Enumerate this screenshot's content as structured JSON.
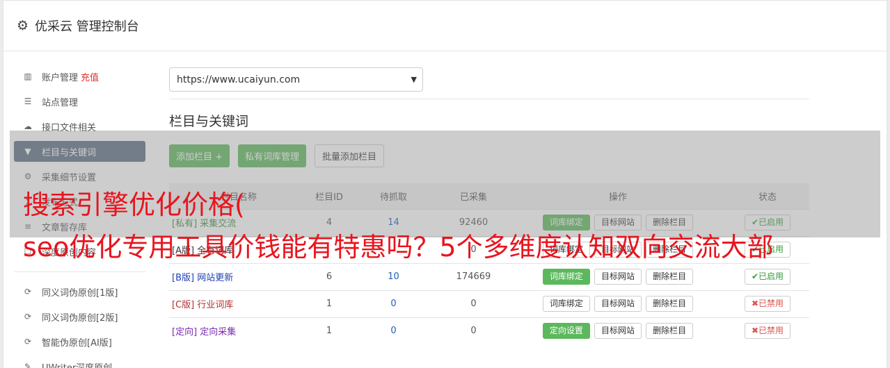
{
  "header": {
    "gear_icon": "gear-icon",
    "title": "优采云 管理控制台"
  },
  "sidebar": {
    "items": [
      {
        "icon": "bar-chart-icon",
        "label": "账户管理",
        "extra": "充值"
      },
      {
        "icon": "server-icon",
        "label": "站点管理"
      },
      {
        "icon": "cloud-upload-icon",
        "label": "接口文件相关"
      },
      {
        "icon": "filter-icon",
        "label": "栏目与关键词"
      },
      {
        "icon": "gears-icon",
        "label": "采集细节设置"
      },
      {
        "icon": "publish-icon",
        "label": "发布方式"
      },
      {
        "icon": "database-icon",
        "label": "文章暂存库"
      },
      {
        "icon": "square-icon",
        "label": "深度原创内容"
      }
    ],
    "items2": [
      {
        "icon": "refresh-icon",
        "label": "同义词伪原创[1版]"
      },
      {
        "icon": "refresh-icon",
        "label": "同义词伪原创[2版]"
      },
      {
        "icon": "refresh-icon",
        "label": "智能伪原创[AI版]"
      },
      {
        "icon": "edit-icon",
        "label": "UWriter深度原创"
      }
    ]
  },
  "site_select": {
    "value": "https://www.ucaiyun.com"
  },
  "section_title": "栏目与关键词",
  "buttons": {
    "add": "添加栏目 +",
    "private_lib": "私有词库管理",
    "batch_add": "批量添加栏目"
  },
  "table": {
    "headers": [
      "栏目名称",
      "栏目ID",
      "待抓取",
      "已采集",
      "操作",
      "状态"
    ],
    "rows": [
      {
        "name": "[私有] 采集交流",
        "color": "#3a8a3a",
        "id": "4",
        "pending": "14",
        "collected": "92460",
        "op1": "词库绑定",
        "op1_green": true,
        "op2": "目标网站",
        "op3": "删除栏目",
        "status": "已启用",
        "on": true
      },
      {
        "name": "[A版] 全有词库",
        "color": "#333333",
        "id": "",
        "pending": "",
        "collected": "0",
        "op1": "词库绑定",
        "op1_green": false,
        "op2": "目标网站",
        "op3": "删除栏目",
        "status": "已启用",
        "on": true
      },
      {
        "name": "[B版] 网站更新",
        "color": "#1e3fb4",
        "id": "6",
        "pending": "10",
        "collected": "174669",
        "op1": "词库绑定",
        "op1_green": true,
        "op2": "目标网站",
        "op3": "删除栏目",
        "status": "已启用",
        "on": true
      },
      {
        "name": "[C版] 行业词库",
        "color": "#b03030",
        "id": "1",
        "pending": "0",
        "collected": "0",
        "op1": "词库绑定",
        "op1_green": false,
        "op2": "目标网站",
        "op3": "删除栏目",
        "status": "已禁用",
        "on": false
      },
      {
        "name": "[定向] 定向采集",
        "color": "#7a2ab0",
        "id": "1",
        "pending": "0",
        "collected": "0",
        "op1": "定向设置",
        "op1_green": true,
        "op2": "目标网站",
        "op3": "删除栏目",
        "status": "已禁用",
        "on": false
      }
    ]
  },
  "ad": {
    "line1": "搜索引擎优化价格(",
    "line2": "seo优化专用工具价钱能有特惠吗？5个多维度认知双向交流大部"
  }
}
